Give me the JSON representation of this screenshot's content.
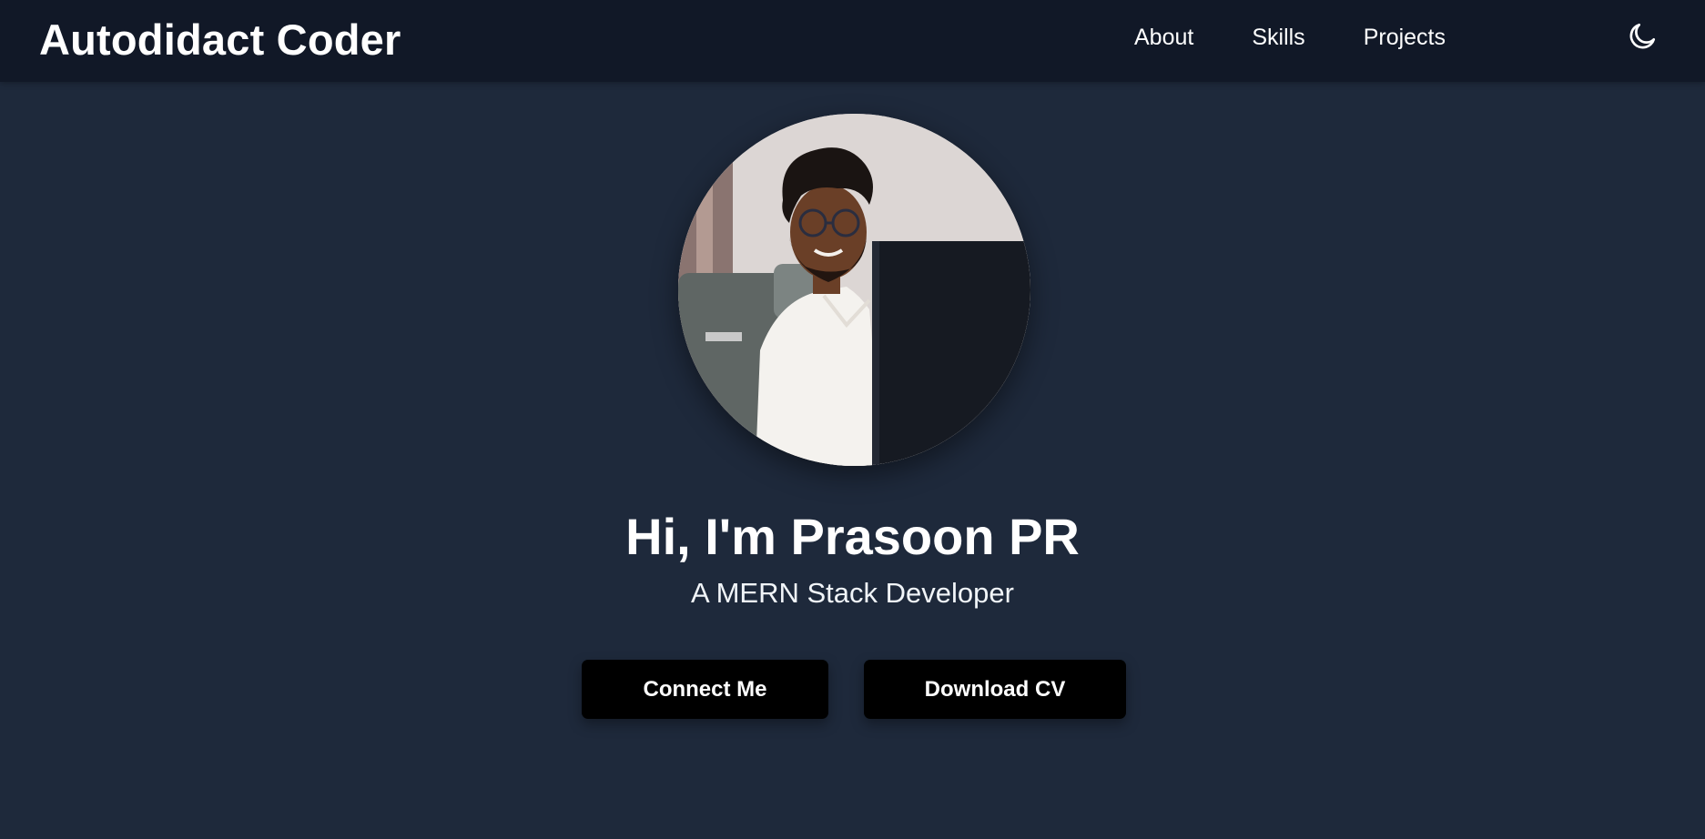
{
  "header": {
    "brand": "Autodidact Coder",
    "nav": [
      {
        "label": "About"
      },
      {
        "label": "Skills"
      },
      {
        "label": "Projects"
      }
    ],
    "theme_toggle_icon": "moon-icon"
  },
  "hero": {
    "avatar_icon": "profile-photo",
    "headline": "Hi, I'm Prasoon PR",
    "subtitle": "A MERN Stack Developer",
    "buttons": {
      "connect": "Connect Me",
      "download_cv": "Download CV"
    }
  },
  "colors": {
    "page_background": "#1e293b",
    "navbar_background": "#111827",
    "button_background": "#000000",
    "text": "#ffffff"
  }
}
